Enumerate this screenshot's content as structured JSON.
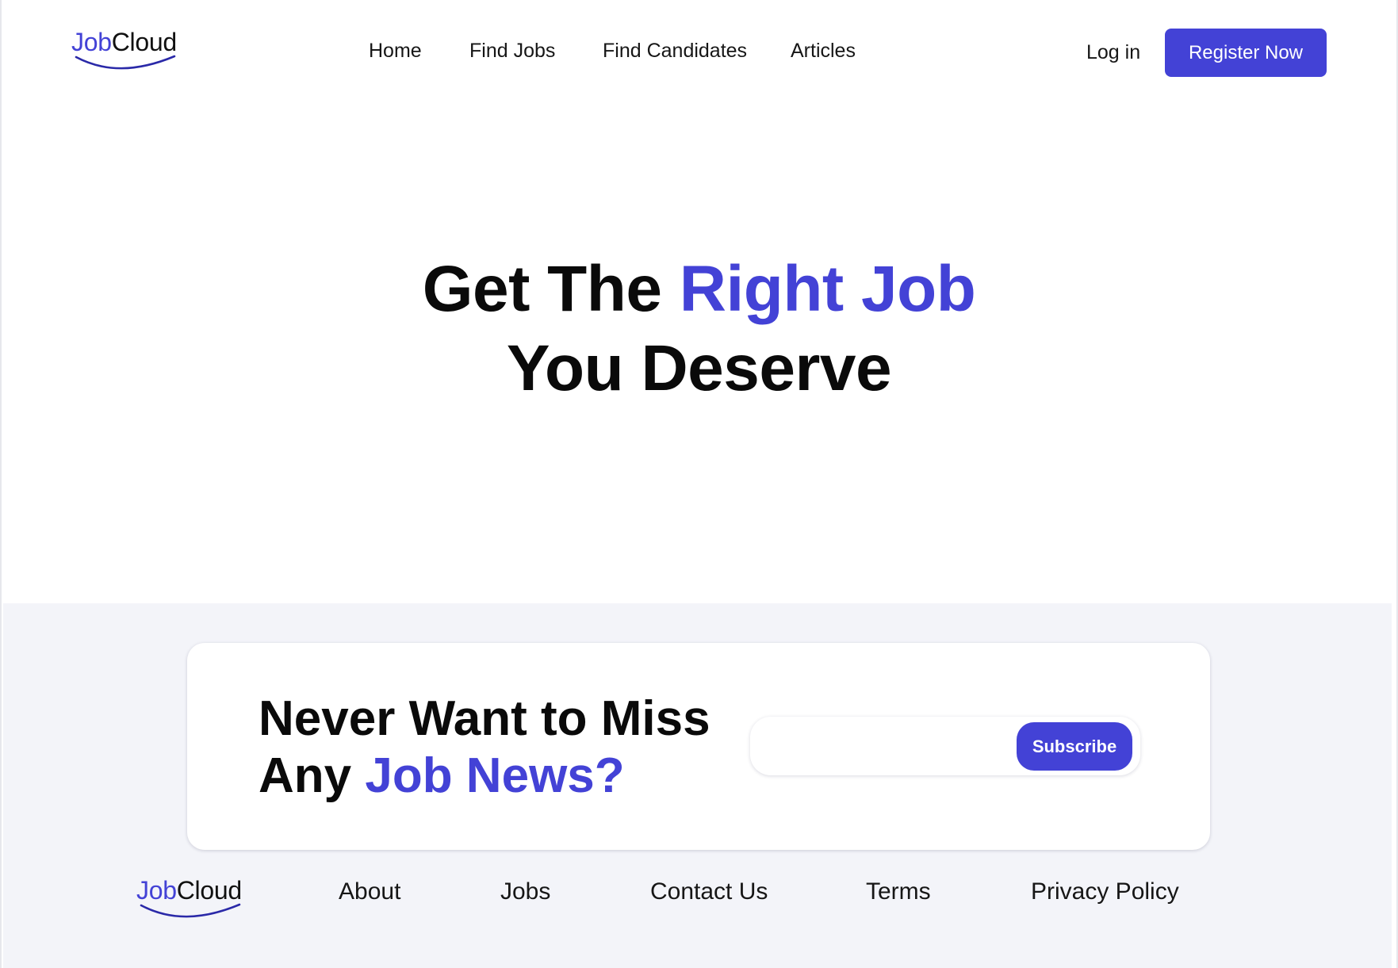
{
  "brand": {
    "logo_part1": "Job",
    "logo_part2": "Cloud",
    "accent_color": "#4342d6",
    "text_color": "#111111",
    "band_background": "#f3f4f9"
  },
  "header": {
    "nav": {
      "home": "Home",
      "find_jobs": "Find Jobs",
      "find_candidates": "Find Candidates",
      "articles": "Articles"
    },
    "login_label": "Log in",
    "register_label": "Register Now"
  },
  "hero": {
    "line1_plain": "Get The ",
    "line1_accent": "Right Job",
    "line2": "You Deserve"
  },
  "newsletter": {
    "line1": "Never Want to Miss",
    "line2_plain": "Any ",
    "line2_accent": "Job News?",
    "email_value": "",
    "subscribe_label": "Subscribe"
  },
  "footer": {
    "links": {
      "about": "About",
      "jobs": "Jobs",
      "contact": "Contact Us",
      "terms": "Terms",
      "privacy": "Privacy Policy"
    }
  }
}
